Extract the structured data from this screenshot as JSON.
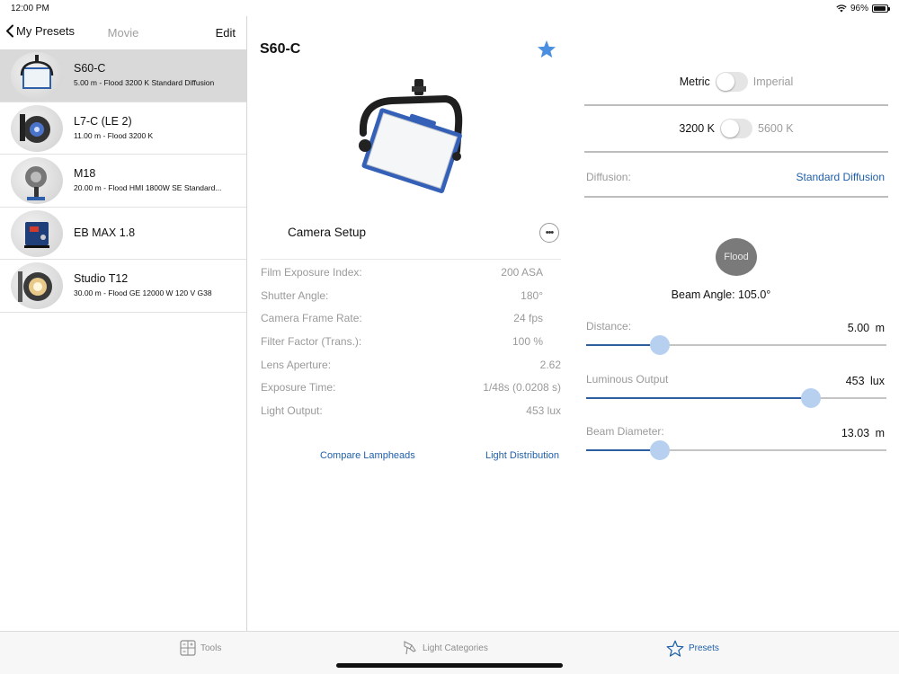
{
  "status": {
    "time": "12:00 PM",
    "battery": "96%",
    "battery_level": 0.96
  },
  "sidebar": {
    "back_label": "My Presets",
    "title": "Movie",
    "edit_label": "Edit",
    "presets": [
      {
        "name": "S60-C",
        "desc": "5.00 m -  Flood 3200 K Standard Diffusion",
        "selected": true
      },
      {
        "name": "L7-C (LE 2)",
        "desc": "11.00 m -  Flood 3200 K"
      },
      {
        "name": "M18",
        "desc": "20.00 m -  Flood HMI 1800W SE Standard..."
      },
      {
        "name": "EB MAX 1.8",
        "desc": ""
      },
      {
        "name": "Studio T12",
        "desc": "30.00 m -  Flood GE 12000 W 120 V G38"
      }
    ]
  },
  "detail": {
    "title": "S60-C",
    "favorite": true,
    "camera_setup": {
      "title": "Camera Setup",
      "more_label": "•••",
      "rows": [
        {
          "label": "Film Exposure Index:",
          "value": "200 ASA"
        },
        {
          "label": "Shutter Angle:",
          "value": "180°"
        },
        {
          "label": "Camera Frame Rate:",
          "value": "24 fps"
        },
        {
          "label": "Filter Factor (Trans.):",
          "value": "100 %"
        },
        {
          "label": "Lens Aperture:",
          "value": "2.62"
        },
        {
          "label": "Exposure Time:",
          "value": "1/48s (0.0208 s)"
        },
        {
          "label": "Light Output:",
          "value": "453 lux"
        }
      ]
    },
    "compare_label": "Compare Lampheads",
    "distribution_label": "Light Distribution"
  },
  "settings": {
    "units": {
      "on": "Metric",
      "off": "Imperial"
    },
    "color_temp": {
      "on": "3200 K",
      "off": "5600 K"
    },
    "diffusion": {
      "label": "Diffusion:",
      "value": "Standard Diffusion"
    },
    "flood_label": "Flood",
    "beam_angle": "Beam Angle: 105.0°",
    "sliders": [
      {
        "label": "Distance:",
        "value": "5.00  m",
        "position": 0.247
      },
      {
        "label": "Luminous Output",
        "value": "453  lux",
        "position": 0.749
      },
      {
        "label": "Beam Diameter:",
        "value": "13.03  m",
        "position": 0.247
      }
    ]
  },
  "tabs": [
    {
      "label": "Tools",
      "icon": "tools-icon"
    },
    {
      "label": "Light Categories",
      "icon": "light-categories-icon"
    },
    {
      "label": "Presets",
      "icon": "star-icon",
      "active": true
    }
  ],
  "colors": {
    "accent": "#1f5fa8",
    "slider_thumb": "#b7d0f0",
    "selected_row": "#d9d9d9"
  }
}
